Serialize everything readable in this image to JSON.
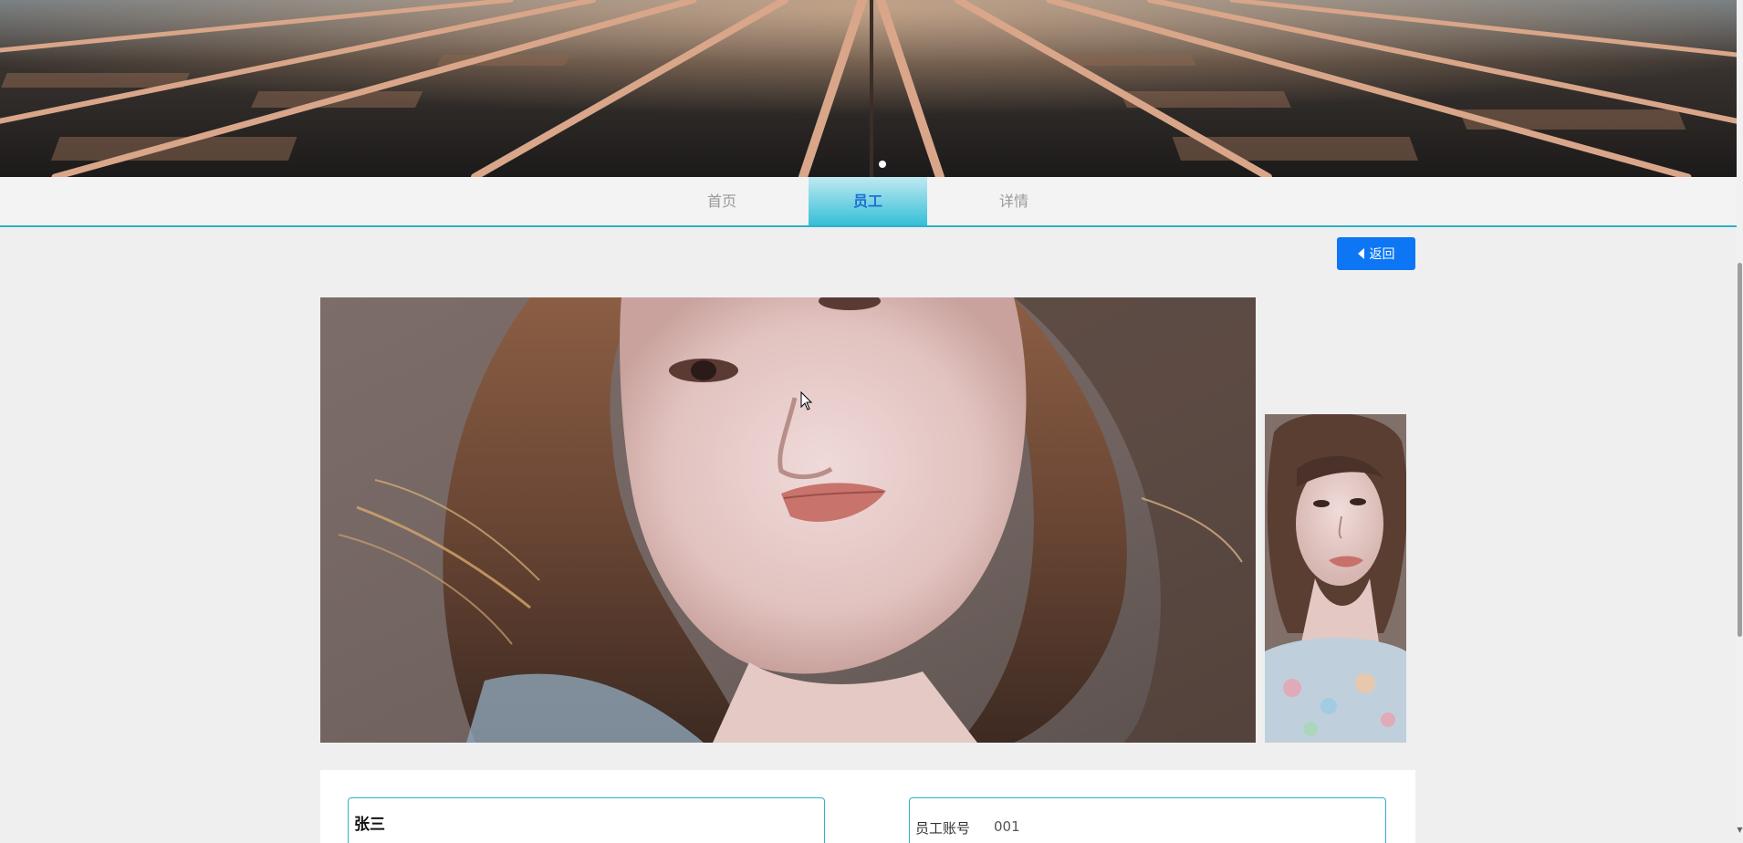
{
  "nav": {
    "items": [
      {
        "label": "首页"
      },
      {
        "label": "员工"
      },
      {
        "label": "详情"
      }
    ],
    "active_index": 1
  },
  "back_button": {
    "label": "返回"
  },
  "banner": {
    "image": "railway-tracks-photo",
    "slide_count": 1,
    "active_slide": 1
  },
  "photos": {
    "main": "portrait-photo",
    "thumbnail": "portrait-photo-thumbnail"
  },
  "info": {
    "name": "张三",
    "fields": [
      {
        "label": "员工账号",
        "value": "001"
      }
    ]
  },
  "colors": {
    "accent": "#2fb1c8",
    "button": "#0d76f5",
    "active_tab_text": "#1f6fd2",
    "background": "#efefef"
  }
}
